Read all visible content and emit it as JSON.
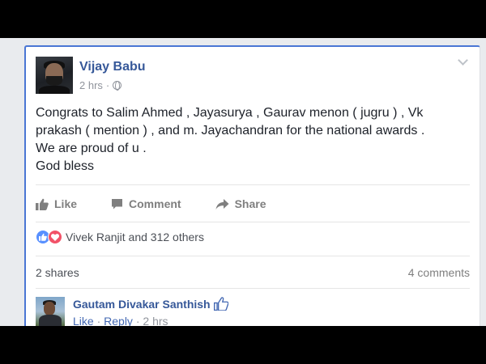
{
  "post": {
    "author": "Vijay Babu",
    "time": "2 hrs",
    "privacy_icon": "globe-icon",
    "menu_icon": "chevron-down-icon",
    "text_lines": [
      "Congrats to Salim Ahmed , Jayasurya , Gaurav menon ( jugru ) , Vk",
      "prakash ( mention ) , and m. Jayachandran for the national awards .",
      "We are proud of u .",
      "God bless"
    ]
  },
  "actions": {
    "like": "Like",
    "comment": "Comment",
    "share": "Share"
  },
  "reactions": {
    "icons": [
      "like-reaction-icon",
      "love-reaction-icon"
    ],
    "summary": "Vivek Ranjit and 312 others"
  },
  "stats": {
    "shares": "2 shares",
    "comments": "4 comments"
  },
  "comment": {
    "author": "Gautam Divakar Santhish",
    "like": "Like",
    "separator1": " · ",
    "reply": "Reply",
    "separator2": " · ",
    "time": "2 hrs"
  },
  "colors": {
    "link_blue": "#365899",
    "accent_border": "#4a76d4",
    "like_blue": "#5890ff",
    "love_red": "#f25268",
    "muted_text": "#90949c"
  }
}
